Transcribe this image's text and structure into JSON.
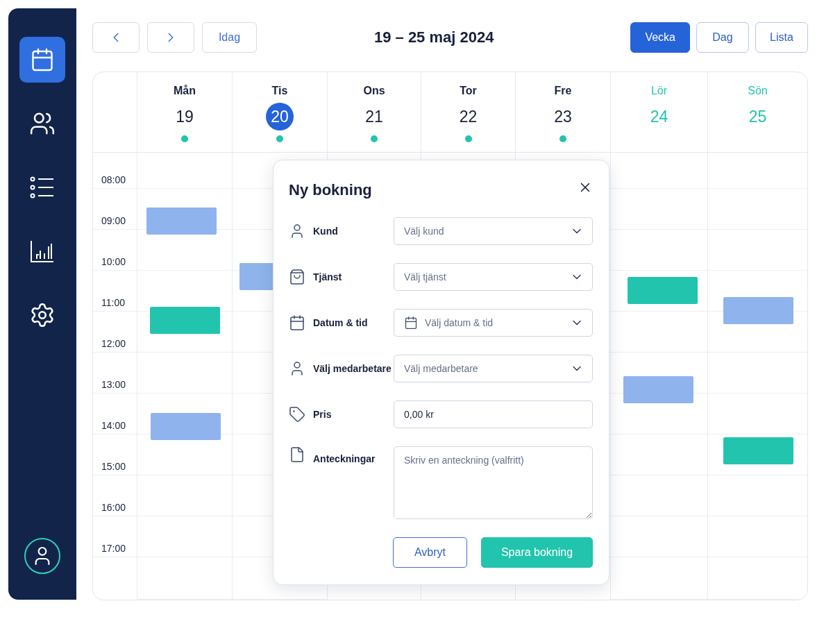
{
  "sidebar": {
    "items": [
      {
        "kind": "calendar",
        "selected": true
      },
      {
        "kind": "users",
        "selected": false
      },
      {
        "kind": "list",
        "selected": false
      },
      {
        "kind": "chart",
        "selected": false
      },
      {
        "kind": "settings",
        "selected": false
      }
    ],
    "profile": {
      "kind": "avatar"
    }
  },
  "toolbar": {
    "today": "Idag",
    "title": "19 – 25 maj 2024",
    "views": [
      {
        "label": "Vecka",
        "selected": true
      },
      {
        "label": "Dag",
        "selected": false
      },
      {
        "label": "Lista",
        "selected": false
      }
    ]
  },
  "calendar": {
    "days": [
      {
        "name": "Mån",
        "date": "19",
        "selected": false,
        "weekend": false,
        "dot": true,
        "events": [
          {
            "color": "#8fb3ec"
          },
          {
            "color": "#22c4ad"
          },
          {
            "color": "#8fb3ec"
          }
        ]
      },
      {
        "name": "Tis",
        "date": "20",
        "selected": true,
        "weekend": false,
        "dot": true,
        "events": [
          {
            "color": "#8fb3ec"
          }
        ]
      },
      {
        "name": "Ons",
        "date": "21",
        "selected": false,
        "weekend": false,
        "dot": true
      },
      {
        "name": "Tor",
        "date": "22",
        "selected": false,
        "weekend": false,
        "dot": true
      },
      {
        "name": "Fre",
        "date": "23",
        "selected": false,
        "weekend": false,
        "dot": true
      },
      {
        "name": "Lör",
        "date": "24",
        "selected": false,
        "weekend": true,
        "events": [
          {
            "color": "#22c4ad"
          },
          {
            "color": "#8fb3ec"
          }
        ]
      },
      {
        "name": "Sön",
        "date": "25",
        "selected": false,
        "weekend": true,
        "events": [
          {
            "color": "#8fb3ec"
          },
          {
            "color": "#22c4ad"
          }
        ]
      }
    ],
    "times": [
      "08:00",
      "09:00",
      "10:00",
      "11:00",
      "12:00",
      "13:00",
      "14:00",
      "15:00",
      "16:00",
      "17:00"
    ]
  },
  "dialog": {
    "title": "Ny bokning",
    "fields": [
      {
        "kind": "select",
        "label": "Kund",
        "placeholder": "Välj kund"
      },
      {
        "kind": "select",
        "label": "Tjänst",
        "placeholder": "Välj tjänst"
      },
      {
        "kind": "date",
        "label": "Datum & tid",
        "placeholder": "Välj datum & tid"
      },
      {
        "kind": "select",
        "label": "Välj medarbetare",
        "placeholder": "Välj medarbetare"
      },
      {
        "kind": "input",
        "label": "Pris",
        "value": "0,00 kr"
      },
      {
        "kind": "textarea",
        "label": "Anteckningar",
        "placeholder": "Skriv en anteckning (valfritt)"
      }
    ],
    "buttons": [
      {
        "label": "Avbryt",
        "kind": "secondary"
      },
      {
        "label": "Spara bokning",
        "kind": "primary"
      }
    ]
  }
}
